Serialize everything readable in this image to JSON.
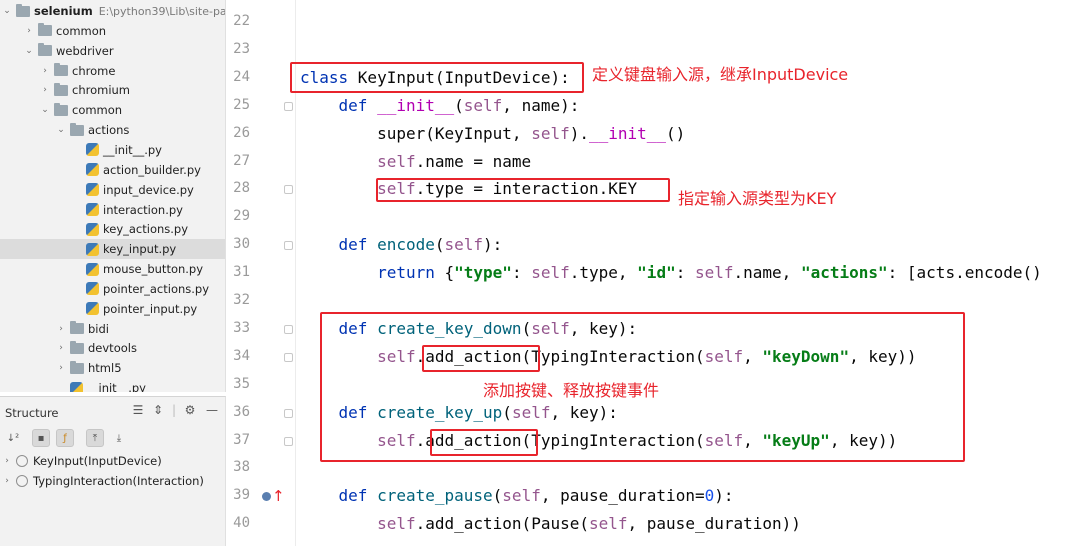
{
  "project_tree": [
    {
      "label": "selenium",
      "path": "E:\\python39\\Lib\\site-pa",
      "type": "folder",
      "expanded": true,
      "depth": 0,
      "bold": true
    },
    {
      "label": "common",
      "type": "folder",
      "expanded": false,
      "depth": 1
    },
    {
      "label": "webdriver",
      "type": "folder",
      "expanded": true,
      "depth": 1
    },
    {
      "label": "chrome",
      "type": "folder",
      "expanded": false,
      "depth": 2
    },
    {
      "label": "chromium",
      "type": "folder",
      "expanded": false,
      "depth": 2
    },
    {
      "label": "common",
      "type": "folder",
      "expanded": true,
      "depth": 2
    },
    {
      "label": "actions",
      "type": "folder",
      "expanded": true,
      "depth": 3
    },
    {
      "label": "__init__.py",
      "type": "file",
      "depth": 4
    },
    {
      "label": "action_builder.py",
      "type": "file",
      "depth": 4
    },
    {
      "label": "input_device.py",
      "type": "file",
      "depth": 4
    },
    {
      "label": "interaction.py",
      "type": "file",
      "depth": 4
    },
    {
      "label": "key_actions.py",
      "type": "file",
      "depth": 4
    },
    {
      "label": "key_input.py",
      "type": "file",
      "depth": 4,
      "selected": true
    },
    {
      "label": "mouse_button.py",
      "type": "file",
      "depth": 4
    },
    {
      "label": "pointer_actions.py",
      "type": "file",
      "depth": 4
    },
    {
      "label": "pointer_input.py",
      "type": "file",
      "depth": 4
    },
    {
      "label": "bidi",
      "type": "folder",
      "expanded": false,
      "depth": 3
    },
    {
      "label": "devtools",
      "type": "folder",
      "expanded": false,
      "depth": 3
    },
    {
      "label": "html5",
      "type": "folder",
      "expanded": false,
      "depth": 3
    },
    {
      "label": "__init__.py",
      "type": "file",
      "depth": 3
    }
  ],
  "structure_panel": {
    "title": "Structure",
    "items": [
      {
        "label": "KeyInput(InputDevice)"
      },
      {
        "label": "TypingInteraction(Interaction)"
      }
    ]
  },
  "editor": {
    "line_numbers": [
      "22",
      "23",
      "24",
      "25",
      "26",
      "27",
      "28",
      "29",
      "30",
      "31",
      "32",
      "33",
      "34",
      "35",
      "36",
      "37",
      "38",
      "39",
      "40"
    ],
    "lines": [
      [],
      [],
      [
        [
          "kw",
          "class "
        ],
        [
          "",
          "KeyInput(InputDevice):"
        ]
      ],
      [
        [
          "",
          "    "
        ],
        [
          "kw",
          "def "
        ],
        [
          "mg",
          "__init__"
        ],
        [
          "",
          "("
        ],
        [
          "sf",
          "self"
        ],
        [
          "",
          ", name):"
        ]
      ],
      [
        [
          "",
          "        "
        ],
        [
          "",
          "super(KeyInput, "
        ],
        [
          "sf",
          "self"
        ],
        [
          "",
          ")."
        ],
        [
          "mg",
          "__init__"
        ],
        [
          "",
          "()"
        ]
      ],
      [
        [
          "",
          "        "
        ],
        [
          "sf",
          "self"
        ],
        [
          "",
          ".name = name"
        ]
      ],
      [
        [
          "",
          "        "
        ],
        [
          "sf",
          "self"
        ],
        [
          "",
          ".type = interaction.KEY"
        ]
      ],
      [],
      [
        [
          "",
          "    "
        ],
        [
          "kw",
          "def "
        ],
        [
          "fn",
          "encode"
        ],
        [
          "",
          "("
        ],
        [
          "sf",
          "self"
        ],
        [
          "",
          "):"
        ]
      ],
      [
        [
          "",
          "        "
        ],
        [
          "kw",
          "return "
        ],
        [
          "",
          "{"
        ],
        [
          "st",
          "\"type\""
        ],
        [
          "",
          ": "
        ],
        [
          "sf",
          "self"
        ],
        [
          "",
          ".type, "
        ],
        [
          "st",
          "\"id\""
        ],
        [
          "",
          ": "
        ],
        [
          "sf",
          "self"
        ],
        [
          "",
          ".name, "
        ],
        [
          "st",
          "\"actions\""
        ],
        [
          "",
          ": [acts.encode()"
        ]
      ],
      [],
      [
        [
          "",
          "    "
        ],
        [
          "kw",
          "def "
        ],
        [
          "fn",
          "create_key_down"
        ],
        [
          "",
          "("
        ],
        [
          "sf",
          "self"
        ],
        [
          "",
          ", key):"
        ]
      ],
      [
        [
          "",
          "        "
        ],
        [
          "sf",
          "self"
        ],
        [
          "",
          ".add_action(TypingInteraction("
        ],
        [
          "sf",
          "self"
        ],
        [
          "",
          ", "
        ],
        [
          "st",
          "\"keyDown\""
        ],
        [
          "",
          ", key))"
        ]
      ],
      [],
      [
        [
          "",
          "    "
        ],
        [
          "kw",
          "def "
        ],
        [
          "fn",
          "create_key_up"
        ],
        [
          "",
          "("
        ],
        [
          "sf",
          "self"
        ],
        [
          "",
          ", key):"
        ]
      ],
      [
        [
          "",
          "        "
        ],
        [
          "sf",
          "self"
        ],
        [
          "",
          ".add_action(TypingInteraction("
        ],
        [
          "sf",
          "self"
        ],
        [
          "",
          ", "
        ],
        [
          "st",
          "\"keyUp\""
        ],
        [
          "",
          ", key))"
        ]
      ],
      [],
      [
        [
          "",
          "    "
        ],
        [
          "kw",
          "def "
        ],
        [
          "fn",
          "create_pause"
        ],
        [
          "",
          "("
        ],
        [
          "sf",
          "self"
        ],
        [
          "",
          ", pause_duration="
        ],
        [
          "nm",
          "0"
        ],
        [
          "",
          "):"
        ]
      ],
      [
        [
          "",
          "        "
        ],
        [
          "sf",
          "self"
        ],
        [
          "",
          ".add_action(Pause("
        ],
        [
          "sf",
          "self"
        ],
        [
          "",
          ", pause_duration))"
        ]
      ]
    ]
  },
  "annotations": {
    "class_note": "定义键盘输入源，继承InputDevice",
    "type_note": "指定输入源类型为KEY",
    "events_note": "添加按键、释放按键事件"
  },
  "colors": {
    "annotation": "#e8242c",
    "keyword": "#0033b3",
    "self": "#94558d",
    "string": "#067d17",
    "magic": "#b200b2",
    "function": "#00627a"
  },
  "icons": {
    "folder": "folder-icon",
    "python_file": "python-file-icon",
    "class": "class-icon",
    "sort_alpha": "sort-alpha-icon",
    "expand": "expand-all-icon",
    "collapse": "collapse-all-icon",
    "settings": "gear-icon",
    "hide": "minimize-icon"
  }
}
